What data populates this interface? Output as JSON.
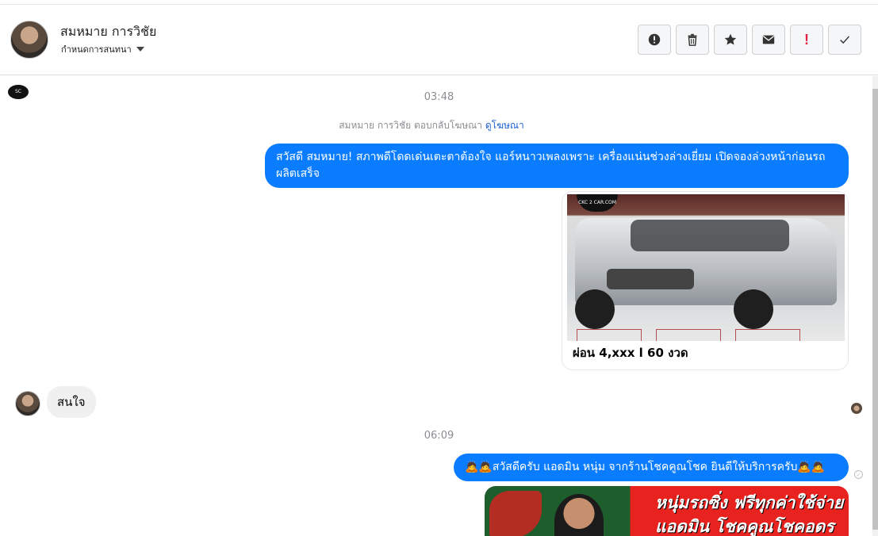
{
  "header": {
    "name": "สมหมาย การวิชัย",
    "sub_label": "กำหนดการสนทนา"
  },
  "actions": [
    {
      "name": "mark-spam-icon"
    },
    {
      "name": "trash-icon"
    },
    {
      "name": "star-icon"
    },
    {
      "name": "mail-icon"
    },
    {
      "name": "follow-up-icon",
      "label": "!"
    },
    {
      "name": "check-icon"
    }
  ],
  "chat": {
    "time1": "03:48",
    "replied_text": "สมหมาย การวิชัย ตอบกลับโฆษณา",
    "replied_link": "ดูโฆษณา",
    "msg_out_1": "สวัสดี สมหมาย! สภาพดีโดดเด่นเตะตาต้องใจ แอร์หนาวเพลงเพราะ เครื่องแน่นช่วงล่างเยี่ยม เปิดจองล่วงหน้าก่อนรถผลิตเสร็จ",
    "card_logo": "CKC 2 CAR.COM",
    "card_text": "ผ่อน 4,xxx l 60 งวด",
    "msg_in_1": "สนใจ",
    "time2": "06:09",
    "msg_out_2": "🙇🙇สวัสดีครับ แอดมิน หนุ่ม จากร้านโชคคูณโชค ยินดีให้บริการครับ🙇🙇",
    "promo_line1": "หนุ่มรถซิ่ง ฟรีทุกค่าใช้จ่าย",
    "promo_line2": "แอดมิน โชคคูณโชคอดร"
  },
  "colors": {
    "outgoing_bubble": "#0a7cff",
    "incoming_bubble": "#f0f0f0",
    "link": "#1b5fd0"
  }
}
